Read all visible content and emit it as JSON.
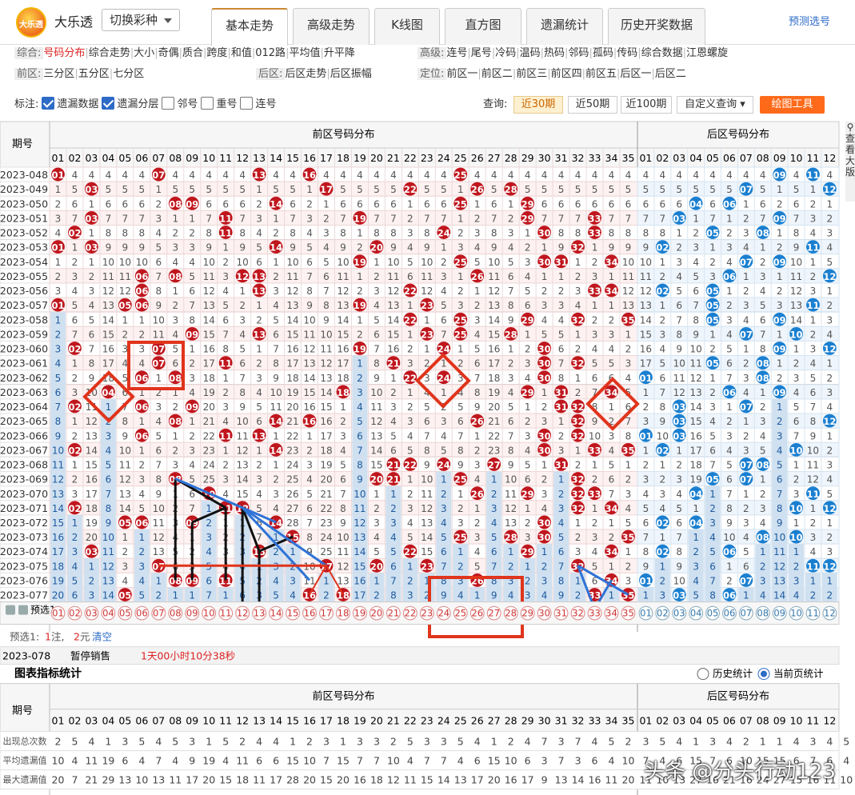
{
  "header": {
    "logo_text": "大乐透",
    "lottery_name": "大乐透",
    "switch_label": "切换彩种",
    "predict_link": "预测选号",
    "tabs": [
      "基本走势",
      "高级走势",
      "K线图",
      "直方图",
      "遗漏统计",
      "历史开奖数据"
    ],
    "active_tab": 0
  },
  "filters": {
    "general_label": "综合:",
    "general_items": [
      "号码分布",
      "综合走势",
      "大小",
      "奇偶",
      "质合",
      "跨度",
      "和值",
      "012路",
      "平均值",
      "升平降"
    ],
    "advanced_label": "高级:",
    "advanced_items": [
      "连号",
      "尾号",
      "冷码",
      "温码",
      "热码",
      "邻码",
      "孤码",
      "传码",
      "综合数据",
      "江恩螺旋"
    ],
    "front_label": "前区:",
    "front_items": [
      "三分区",
      "五分区",
      "七分区"
    ],
    "back_label": "后区:",
    "back_items": [
      "后区走势",
      "后区振幅"
    ],
    "pos_label": "定位:",
    "pos_items": [
      "前区一",
      "前区二",
      "前区三",
      "前区四",
      "前区五",
      "后区一",
      "后区二"
    ]
  },
  "marks": {
    "label": "标注:",
    "items": [
      {
        "label": "遗漏数据",
        "checked": true
      },
      {
        "label": "遗漏分层",
        "checked": true
      },
      {
        "label": "邻号",
        "checked": false
      },
      {
        "label": "重号",
        "checked": false
      },
      {
        "label": "连号",
        "checked": false
      }
    ]
  },
  "query": {
    "label": "查询:",
    "options": [
      "近30期",
      "近50期",
      "近100期"
    ],
    "active": 0,
    "custom": "自定义查询",
    "draw_tool": "绘图工具"
  },
  "sidebar_text": "查看大版",
  "table": {
    "issue_header": "期号",
    "front_header": "前区号码分布",
    "back_header": "后区号码分布",
    "front_cols": [
      "01",
      "02",
      "03",
      "04",
      "05",
      "06",
      "07",
      "08",
      "09",
      "10",
      "11",
      "12",
      "13",
      "14",
      "15",
      "16",
      "17",
      "18",
      "19",
      "20",
      "21",
      "22",
      "23",
      "24",
      "25",
      "26",
      "27",
      "28",
      "29",
      "30",
      "31",
      "32",
      "33",
      "34",
      "35"
    ],
    "back_cols": [
      "01",
      "02",
      "03",
      "04",
      "05",
      "06",
      "07",
      "08",
      "09",
      "10",
      "11",
      "12"
    ],
    "rows": [
      {
        "issue": "2023-048",
        "front": [
          1,
          7,
          13,
          16,
          25
        ],
        "back": [
          9,
          11
        ]
      },
      {
        "issue": "2023-049",
        "front": [
          3,
          17,
          22,
          26,
          28
        ],
        "back": [
          7,
          12
        ]
      },
      {
        "issue": "2023-050",
        "front": [
          8,
          9,
          14,
          25,
          29
        ],
        "back": [
          4,
          6
        ]
      },
      {
        "issue": "2023-051",
        "front": [
          3,
          11,
          19,
          29,
          33
        ],
        "back": [
          3,
          9
        ]
      },
      {
        "issue": "2023-052",
        "front": [
          2,
          11,
          30,
          33,
          24
        ],
        "back": [
          5,
          8
        ]
      },
      {
        "issue": "2023-053",
        "front": [
          1,
          3,
          14,
          20,
          32
        ],
        "back": [
          2,
          11
        ]
      },
      {
        "issue": "2023-054",
        "front": [
          19,
          25,
          30,
          31,
          34
        ],
        "back": [
          7,
          9
        ]
      },
      {
        "issue": "2023-055",
        "front": [
          6,
          8,
          12,
          13,
          26
        ],
        "back": [
          6,
          12
        ]
      },
      {
        "issue": "2023-056",
        "front": [
          6,
          13,
          22,
          33,
          34
        ],
        "back": [
          2,
          5
        ]
      },
      {
        "issue": "2023-057",
        "front": [
          1,
          5,
          6,
          19,
          23
        ],
        "back": [
          5,
          11
        ]
      },
      {
        "issue": "2023-058",
        "front": [
          22,
          29,
          32,
          35,
          25
        ],
        "back": [
          5,
          9
        ]
      },
      {
        "issue": "2023-059",
        "front": [
          9,
          13,
          23,
          25,
          28
        ],
        "back": [
          7,
          10
        ]
      },
      {
        "issue": "2023-060",
        "front": [
          2,
          7,
          19,
          24,
          30
        ],
        "back": [
          9,
          12
        ]
      },
      {
        "issue": "2023-061",
        "front": [
          7,
          11,
          21,
          30,
          32
        ],
        "back": [
          5,
          8
        ]
      },
      {
        "issue": "2023-062",
        "front": [
          6,
          8,
          22,
          24,
          30
        ],
        "back": [
          1,
          8
        ]
      },
      {
        "issue": "2023-063",
        "front": [
          4,
          18,
          29,
          31,
          34
        ],
        "back": [
          6,
          9
        ]
      },
      {
        "issue": "2023-064",
        "front": [
          2,
          6,
          9,
          31,
          32
        ],
        "back": [
          3,
          7
        ]
      },
      {
        "issue": "2023-065",
        "front": [
          8,
          14,
          16,
          26,
          32
        ],
        "back": [
          3,
          12
        ]
      },
      {
        "issue": "2023-066",
        "front": [
          6,
          11,
          13,
          30,
          32
        ],
        "back": [
          1,
          3
        ]
      },
      {
        "issue": "2023-067",
        "front": [
          2,
          14,
          30,
          33,
          35
        ],
        "back": [
          2,
          10
        ]
      },
      {
        "issue": "2023-068",
        "front": [
          21,
          22,
          24,
          27,
          31
        ],
        "back": [
          7,
          8
        ]
      },
      {
        "issue": "2023-069",
        "front": [
          8,
          20,
          21,
          25,
          32
        ],
        "back": [
          5,
          7
        ]
      },
      {
        "issue": "2023-070",
        "front": [
          10,
          26,
          29,
          32,
          33
        ],
        "back": [
          4,
          11
        ]
      },
      {
        "issue": "2023-071",
        "front": [
          2,
          11,
          12,
          32,
          34
        ],
        "back": [
          10,
          12
        ]
      },
      {
        "issue": "2023-072",
        "front": [
          5,
          6,
          9,
          14,
          30
        ],
        "back": [
          2,
          4
        ]
      },
      {
        "issue": "2023-073",
        "front": [
          15,
          25,
          28,
          30,
          35
        ],
        "back": [
          8,
          10
        ]
      },
      {
        "issue": "2023-074",
        "front": [
          3,
          13,
          22,
          29,
          34
        ],
        "back": [
          2,
          6
        ]
      },
      {
        "issue": "2023-075",
        "front": [
          7,
          17,
          20,
          23,
          32
        ],
        "back": [
          11,
          12
        ]
      },
      {
        "issue": "2023-076",
        "front": [
          8,
          9,
          11,
          26,
          34
        ],
        "back": [
          1,
          7
        ]
      },
      {
        "issue": "2023-077",
        "front": [
          5,
          16,
          18,
          33,
          35
        ],
        "back": [
          3,
          6
        ]
      }
    ],
    "preselect_label": "预选1",
    "preselect_info": "预选1:",
    "preselect_count": "1",
    "preselect_unit1": "注,",
    "preselect_money": "2",
    "preselect_unit2": "元",
    "preselect_clear": "清空",
    "next_issue": "2023-078",
    "sale_status": "暂停销售",
    "countdown": "1天00小时10分38秒"
  },
  "stats": {
    "title": "图表指标统计",
    "radio_history": "历史统计",
    "radio_current": "当前页统计",
    "issue_header": "期号",
    "front_header": "前区号码分布",
    "back_header": "后区号码分布",
    "row_labels": [
      "出现总次数",
      "平均遗漏值",
      "最大遗漏值"
    ],
    "row1": [
      "2",
      "5",
      "4",
      "1",
      "3",
      "5",
      "4",
      "5",
      "3",
      "1",
      "5",
      "2",
      "4",
      "4",
      "1",
      "2",
      "3",
      "1",
      "3",
      "3",
      "2",
      "5",
      "3",
      "3",
      "5",
      "4",
      "1",
      "2",
      "4",
      "7",
      "3",
      "7",
      "4",
      "5",
      "2",
      "3",
      "5",
      "4",
      "1",
      "3",
      "4",
      "2",
      "1",
      "1",
      "4",
      "3",
      "4",
      "5"
    ],
    "row2": [
      "10",
      "4",
      "11",
      "19",
      "6",
      "4",
      "7",
      "4",
      "9",
      "19",
      "4",
      "11",
      "6",
      "6",
      "15",
      "10",
      "7",
      "15",
      "7",
      "7",
      "10",
      "4",
      "7",
      "7",
      "4",
      "6",
      "15",
      "10",
      "6",
      "3",
      "7",
      "3",
      "6",
      "4",
      "10",
      "7",
      "4",
      "6",
      "15",
      "7",
      "6",
      "10",
      "15",
      "15",
      "6",
      "7",
      "6",
      "4"
    ],
    "row3": [
      "20",
      "7",
      "21",
      "29",
      "13",
      "10",
      "13",
      "11",
      "17",
      "20",
      "15",
      "18",
      "11",
      "17",
      "28",
      "20",
      "15",
      "20",
      "16",
      "18",
      "12",
      "11",
      "15",
      "14",
      "13",
      "17",
      "20",
      "16",
      "17",
      "9",
      "13",
      "14",
      "16",
      "11",
      "20",
      "11",
      "10",
      "13",
      "27",
      "16",
      "21",
      "16",
      "24",
      "27",
      "15",
      "16",
      "11",
      "10"
    ]
  },
  "watermark": "头条 @分头行动123"
}
